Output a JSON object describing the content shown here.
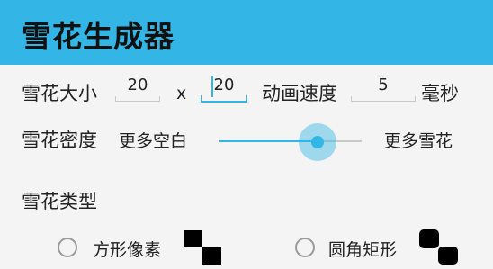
{
  "header": {
    "title": "雪花生成器"
  },
  "snow_size": {
    "label": "雪花大小",
    "width": "20",
    "separator": "x",
    "height": "20"
  },
  "anim_speed": {
    "label": "动画速度",
    "value": "5",
    "unit": "毫秒"
  },
  "density": {
    "label": "雪花密度",
    "min_label": "更多空白",
    "max_label": "更多雪花",
    "value_fraction": 0.69
  },
  "type": {
    "label": "雪花类型",
    "options": [
      {
        "label": "方形像素",
        "selected": false
      },
      {
        "label": "圆角矩形",
        "selected": false
      }
    ]
  },
  "colors": {
    "accent": "#33b5e5",
    "text": "#222222",
    "background": "#f4f4f4"
  }
}
